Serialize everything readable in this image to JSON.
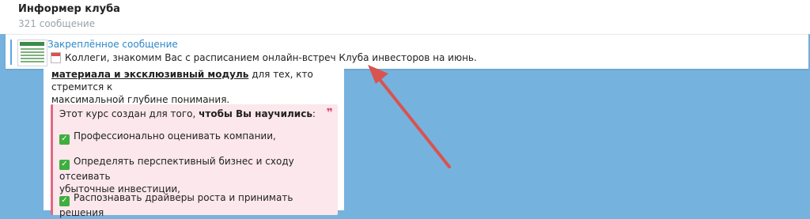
{
  "header": {
    "title": "Информер клуба",
    "subtitle": "321 сообщение"
  },
  "pinned": {
    "label": "Закреплённое сообщение",
    "text": "Коллеги, знакомим Вас с расписанием онлайн-встреч Клуба инвесторов на июнь."
  },
  "message": {
    "line1_bold": "материала и эксклюзивный модуль",
    "line1_rest": " для тех, кто стремится к",
    "line2": "максимальной глубине понимания.",
    "quote": {
      "intro_plain": "Этот курс создан для того, ",
      "intro_bold": "чтобы Вы научились",
      "intro_end": ":",
      "items": [
        "Профессионально оценивать компании,",
        "Определять перспективный бизнес и сходу отсеивать",
        "убыточные инвестиции,",
        "Распознавать драйверы роста и принимать решения"
      ]
    }
  },
  "colors": {
    "chat_background": "#76b2de",
    "link_blue": "#2e88c8",
    "arrow_red": "#d9534f"
  }
}
